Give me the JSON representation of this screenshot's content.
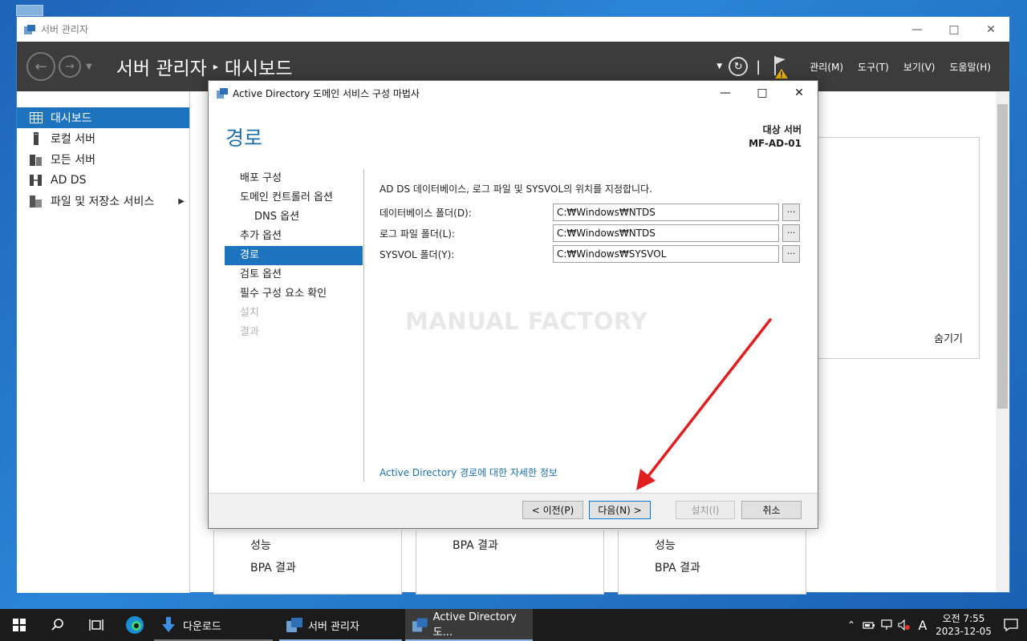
{
  "sm": {
    "window_title": "서버 관리자",
    "breadcrumb_root": "서버 관리자",
    "breadcrumb_page": "대시보드",
    "menus": [
      "관리(M)",
      "도구(T)",
      "보기(V)",
      "도움말(H)"
    ],
    "sidebar": [
      {
        "label": "대시보드",
        "icon": "dashboard-icon"
      },
      {
        "label": "로컬 서버",
        "icon": "server-icon"
      },
      {
        "label": "모든 서버",
        "icon": "servers-icon"
      },
      {
        "label": "AD DS",
        "icon": "adds-icon"
      },
      {
        "label": "파일 및 저장소 서비스",
        "icon": "storage-icon"
      }
    ],
    "hide_label": "숨기기",
    "tiles": {
      "t1_line1": "성능",
      "t1_line2": "BPA 결과",
      "t2_line1": "BPA 결과",
      "t3_line1": "성능",
      "t3_line2": "BPA 결과"
    }
  },
  "dialog": {
    "title": "Active Directory 도메인 서비스 구성 마법사",
    "heading": "경로",
    "target_label": "대상 서버",
    "target_server": "MF-AD-01",
    "nav": [
      {
        "label": "배포 구성",
        "state": "normal"
      },
      {
        "label": "도메인 컨트롤러 옵션",
        "state": "normal"
      },
      {
        "label": "DNS 옵션",
        "state": "sub"
      },
      {
        "label": "추가 옵션",
        "state": "normal"
      },
      {
        "label": "경로",
        "state": "active"
      },
      {
        "label": "검토 옵션",
        "state": "normal"
      },
      {
        "label": "필수 구성 요소 확인",
        "state": "normal"
      },
      {
        "label": "설치",
        "state": "disabled"
      },
      {
        "label": "결과",
        "state": "disabled"
      }
    ],
    "description": "AD DS 데이터베이스, 로그 파일 및 SYSVOL의 위치를 지정합니다.",
    "fields": {
      "db_label": "데이터베이스 폴더(D):",
      "db_value": "C:₩Windows₩NTDS",
      "log_label": "로그 파일 폴더(L):",
      "log_value": "C:₩Windows₩NTDS",
      "sysvol_label": "SYSVOL 폴더(Y):",
      "sysvol_value": "C:₩Windows₩SYSVOL",
      "browse_label": "..."
    },
    "watermark": "MANUAL FACTORY",
    "more_link": "Active Directory 경로에 대한 자세한 정보",
    "buttons": {
      "prev": "< 이전(P)",
      "next": "다음(N) >",
      "install": "설치(I)",
      "cancel": "취소"
    }
  },
  "taskbar": {
    "apps": [
      "다운로드",
      "서버 관리자",
      "Active Directory 도..."
    ],
    "ime": "A",
    "time": "오전 7:55",
    "date": "2023-12-05"
  },
  "colors": {
    "accent": "#1e73be",
    "header": "#3c3c3c",
    "arrow": "#e02020"
  }
}
